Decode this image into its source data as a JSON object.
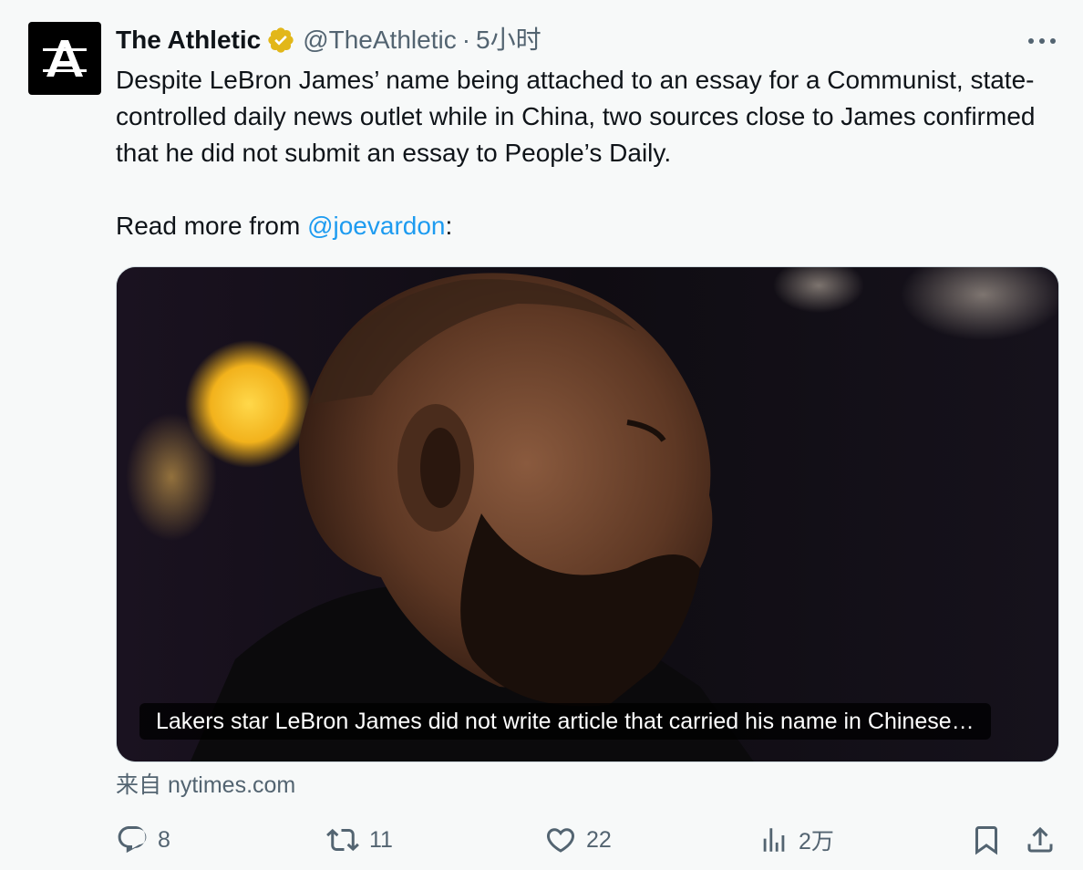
{
  "author": {
    "display_name": "The Athletic",
    "handle": "@TheAthletic",
    "separator": "·",
    "time": "5小时",
    "avatar_letter": "A"
  },
  "tweet": {
    "paragraph_1": "Despite LeBron James’ name being attached to an essay for a Communist, state-controlled daily news outlet while in China, two sources close to James confirmed that he did not submit an essay to People’s Daily.",
    "read_more_prefix": "Read more from ",
    "mention": "@joevardon",
    "read_more_suffix": ":"
  },
  "card": {
    "caption": "Lakers star LeBron James did not write article that carried his name in Chinese…",
    "source": "来自 nytimes.com"
  },
  "actions": {
    "reply_count": "8",
    "retweet_count": "11",
    "like_count": "22",
    "views_count": "2万"
  },
  "icons": {
    "verified": "verified-badge-icon",
    "more": "more-icon",
    "reply": "reply-icon",
    "retweet": "retweet-icon",
    "like": "like-icon",
    "views": "views-icon",
    "bookmark": "bookmark-icon",
    "share": "share-icon"
  },
  "colors": {
    "link": "#1d9bf0",
    "secondary_text": "#536471",
    "verified_gold": "#e2b719"
  }
}
